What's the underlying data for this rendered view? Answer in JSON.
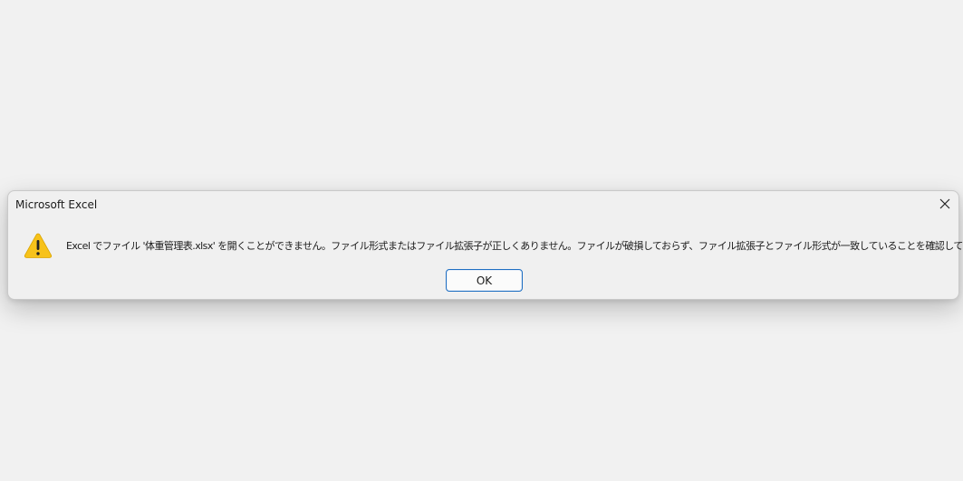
{
  "dialog": {
    "title": "Microsoft Excel",
    "close_icon": "close-icon",
    "warning_icon": "warning-icon",
    "message": "Excel でファイル '体重管理表.xlsx' を開くことができません。ファイル形式またはファイル拡張子が正しくありません。ファイルが破損しておらず、ファイル拡張子とファイル形式が一致していることを確認してください。",
    "ok_label": "OK",
    "colors": {
      "accent": "#1f6fc2",
      "warning": "#f7c21a"
    }
  }
}
